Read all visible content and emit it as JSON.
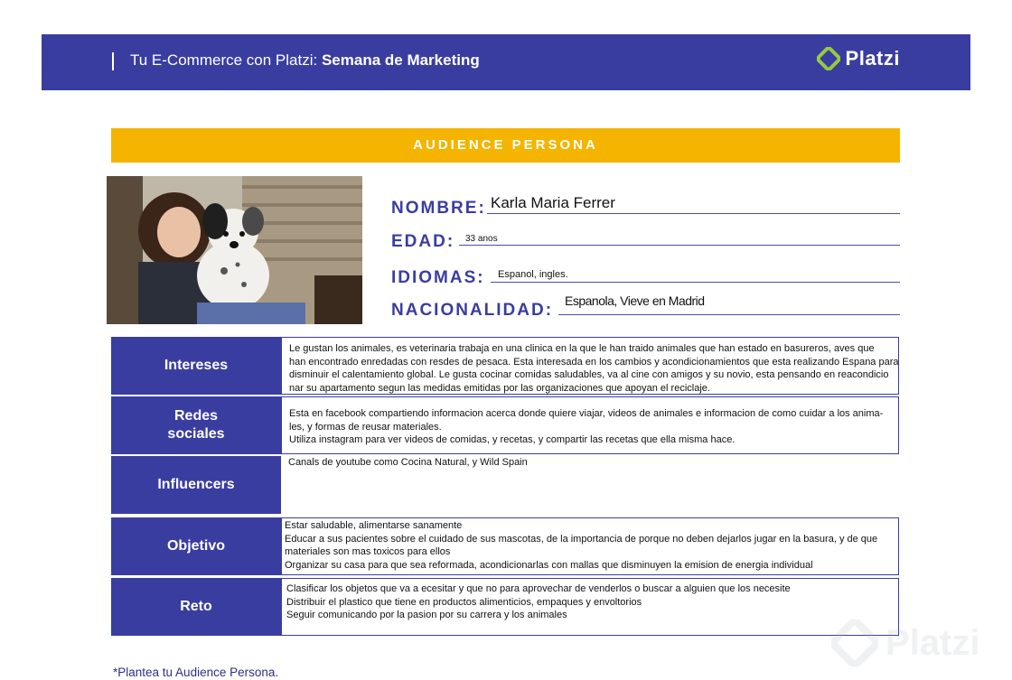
{
  "header": {
    "title_prefix": "Tu E-Commerce con Platzi:",
    "title_bold": "Semana de Marketing",
    "logo_text": "Platzi",
    "logo_icon": "platzi-logo-icon"
  },
  "colors": {
    "header_bg": "#3a3da0",
    "banner_bg": "#f4b400",
    "logo_green": "#98ca3f"
  },
  "banner": {
    "title": "AUDIENCE PERSONA"
  },
  "persona": {
    "nombre_label": "NOMBRE:",
    "nombre_value": "Karla Maria Ferrer",
    "edad_label": "EDAD:",
    "edad_value": "33 anos",
    "idiomas_label": "IDIOMAS:",
    "idiomas_value": "Espanol, ingles.",
    "nacionalidad_label": "NACIONALIDAD:",
    "nacionalidad_value": "Espanola, Vieve en Madrid"
  },
  "sections": {
    "intereses": {
      "label": "Intereses",
      "lines": [
        "Le gustan los animales, es veterinaria trabaja en una clinica en la que le han traido animales que han estado en basureros, aves que",
        "han encontrado enredadas con resdes de pesaca. Esta interesada en los cambios y acondicionamientos que esta realizando Espana para",
        "disminuir el calentamiento global.  Le gusta cocinar comidas saludables, va al cine con amigos y su novio, esta pensando en reacondicio",
        "nar su apartamento segun las medidas emitidas por las organizaciones que apoyan el reciclaje."
      ]
    },
    "redes": {
      "label_line1": "Redes",
      "label_line2": "sociales",
      "lines": [
        "Esta en facebook compartiendo informacion acerca donde quiere viajar, videos de animales e informacion de como cuidar a los anima-",
        "les, y formas de reusar materiales.",
        "Utiliza instagram para ver videos de comidas, y recetas, y compartir las recetas que ella misma hace."
      ]
    },
    "influencers": {
      "label": "Influencers",
      "lines": [
        "Canals de youtube como Cocina Natural, y Wild Spain"
      ]
    },
    "objetivo": {
      "label": "Objetivo",
      "lines": [
        "Estar saludable, alimentarse sanamente",
        "Educar a sus pacientes sobre el cuidado de sus mascotas, de la importancia de porque no deben dejarlos jugar en la basura, y de que",
        "materiales son mas toxicos para ellos",
        "Organizar su casa para que sea reformada, acondicionarlas con mallas que disminuyen la emision de energia individual"
      ]
    },
    "reto": {
      "label": "Reto",
      "lines": [
        "Clasificar los objetos que va a ecesitar y que no para aprovechar de venderlos o buscar a alguien que los necesite",
        "Distribuir el plastico que tiene en productos alimenticios, empaques y envoltorios",
        "Seguir comunicando por la pasion por su carrera y los animales"
      ]
    }
  },
  "footnote": "*Plantea tu Audience Persona.",
  "watermark": {
    "text": "Platzi"
  }
}
